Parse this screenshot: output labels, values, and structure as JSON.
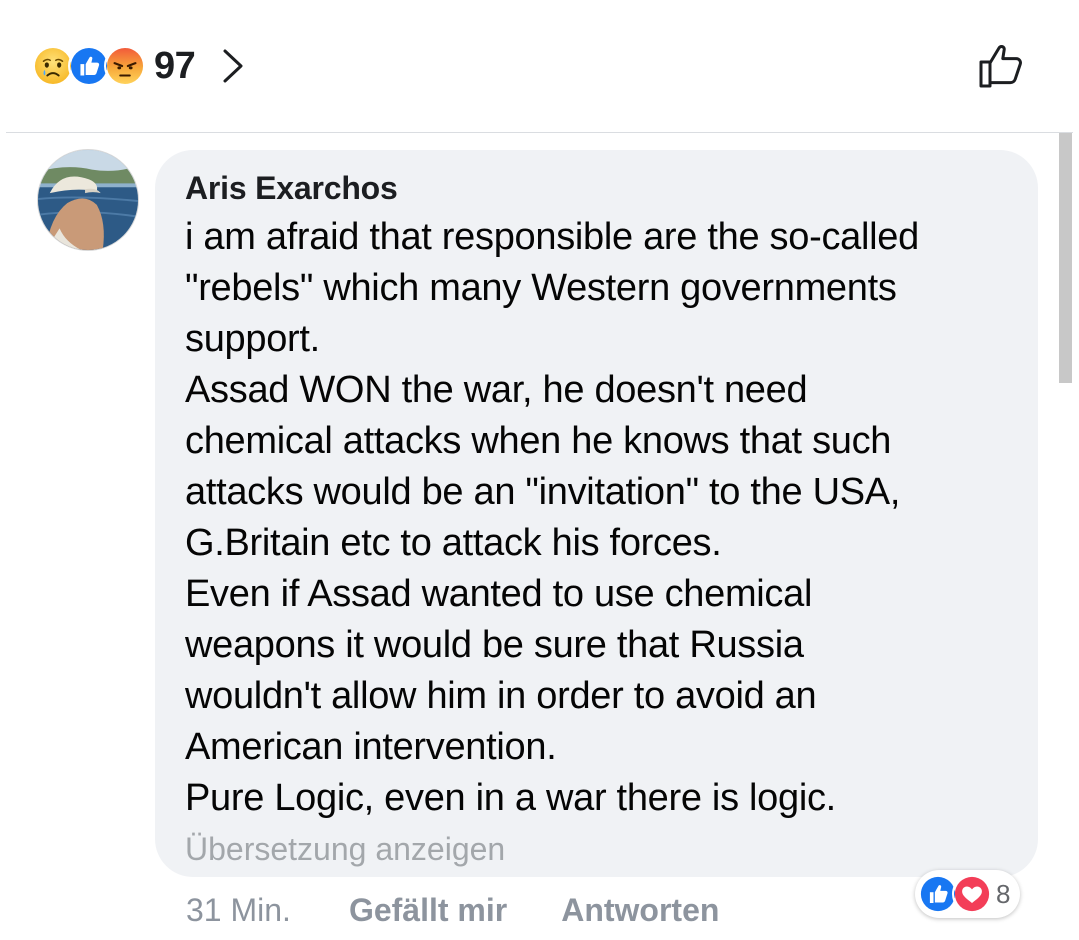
{
  "reactions_summary": {
    "icons": [
      "sad-reaction-icon",
      "like-reaction-icon",
      "angry-reaction-icon"
    ],
    "count": "97"
  },
  "comment": {
    "author": "Aris Exarchos",
    "lines": [
      "i am afraid that responsible are the so-called",
      "\"rebels\" which many Western governments",
      "support.",
      "Assad WON the war, he doesn't need",
      "chemical attacks when he knows that such",
      "attacks would be an \"invitation\" to the USA,",
      "G.Britain etc to attack his forces.",
      "Even if Assad wanted to use chemical",
      "weapons it would be sure that Russia",
      "wouldn't allow him in order to avoid an",
      "American intervention.",
      "Pure Logic, even in a war there is logic."
    ],
    "translate_label": "Übersetzung anzeigen",
    "time": "31 Min.",
    "like_label": "Gefällt mir",
    "reply_label": "Antworten",
    "reactions": {
      "icons": [
        "like-reaction-icon",
        "love-reaction-icon"
      ],
      "count": "8"
    }
  },
  "colors": {
    "bubble_bg": "#f0f2f5",
    "like_blue": "#1877f2",
    "love_red": "#f33e58",
    "meta_gray": "#8d949e",
    "text": "#050505"
  }
}
